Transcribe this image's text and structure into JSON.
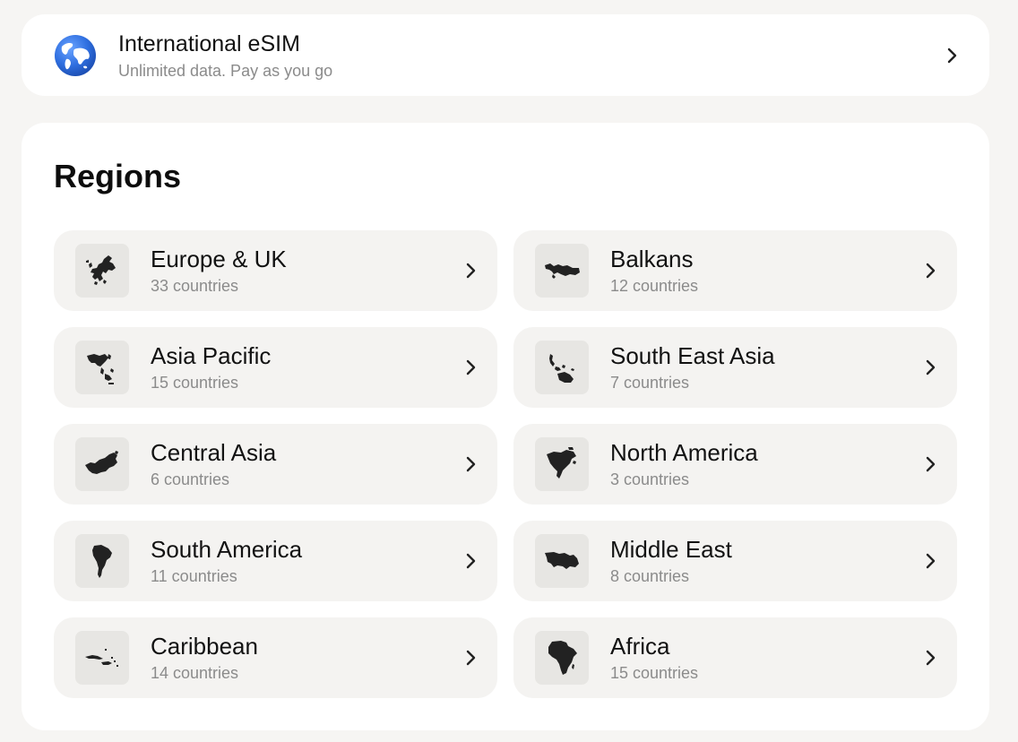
{
  "international": {
    "title": "International eSIM",
    "subtitle": "Unlimited data. Pay as you go",
    "icon": "globe-icon"
  },
  "regions": {
    "heading": "Regions",
    "items": [
      {
        "name": "Europe & UK",
        "count": "33 countries",
        "icon": "europe-map-icon"
      },
      {
        "name": "Balkans",
        "count": "12 countries",
        "icon": "balkans-map-icon"
      },
      {
        "name": "Asia Pacific",
        "count": "15 countries",
        "icon": "asia-pacific-map-icon"
      },
      {
        "name": "South East Asia",
        "count": "7 countries",
        "icon": "south-east-asia-map-icon"
      },
      {
        "name": "Central Asia",
        "count": "6 countries",
        "icon": "central-asia-map-icon"
      },
      {
        "name": "North America",
        "count": "3 countries",
        "icon": "north-america-map-icon"
      },
      {
        "name": "South America",
        "count": "11 countries",
        "icon": "south-america-map-icon"
      },
      {
        "name": "Middle East",
        "count": "8 countries",
        "icon": "middle-east-map-icon"
      },
      {
        "name": "Caribbean",
        "count": "14 countries",
        "icon": "caribbean-map-icon"
      },
      {
        "name": "Africa",
        "count": "15 countries",
        "icon": "africa-map-icon"
      }
    ]
  },
  "colors": {
    "background": "#f6f5f3",
    "card": "#ffffff",
    "tile": "#f4f3f1",
    "muted_text": "#8b8b8b",
    "globe_blue": "#2f6fe0"
  }
}
